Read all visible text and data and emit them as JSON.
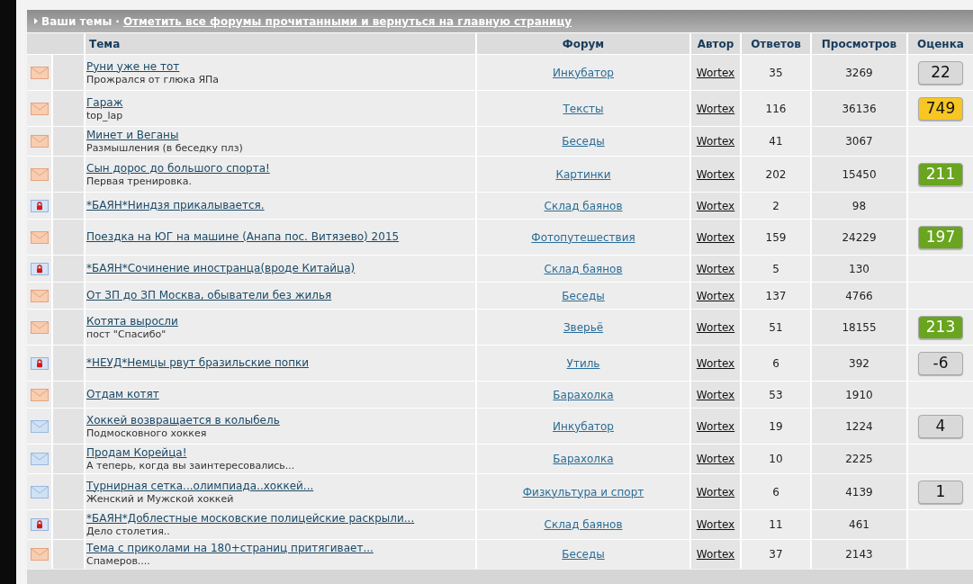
{
  "section_bar": {
    "title": "Ваши темы",
    "separator": "·",
    "link": "Отметить все форумы прочитанными и вернуться на главную страницу"
  },
  "table": {
    "columns": [
      "Тема",
      "Форум",
      "Автор",
      "Ответов",
      "Просмотров",
      "Оценка"
    ],
    "rows": [
      {
        "hot": true,
        "closed": false,
        "title": "Руни уже не тот",
        "subtitle": "Прожрался от глюка ЯПа",
        "forum": "Инкубатор",
        "author": "Wortex",
        "replies": "35",
        "views": "3269",
        "rating": {
          "value": "22",
          "color": "#d9d9d9"
        }
      },
      {
        "hot": true,
        "closed": false,
        "title": "Гараж",
        "subtitle": "top_lap",
        "forum": "Тексты",
        "author": "Wortex",
        "replies": "116",
        "views": "36136",
        "rating": {
          "value": "749",
          "color": "#f8c623"
        }
      },
      {
        "hot": true,
        "closed": false,
        "title": "Минет и Веганы",
        "subtitle": "Размышления (в беседку плз)",
        "forum": "Беседы",
        "author": "Wortex",
        "replies": "41",
        "views": "3067"
      },
      {
        "hot": true,
        "closed": false,
        "title": "Сын дорос до большого спорта!",
        "subtitle": "Первая тренировка.",
        "forum": "Картинки",
        "author": "Wortex",
        "replies": "202",
        "views": "15450",
        "rating": {
          "value": "211",
          "color": "#69a51e"
        }
      },
      {
        "hot": false,
        "closed": true,
        "title": "*БАЯН*Ниндзя прикалывается.",
        "forum": "Склад баянов",
        "author": "Wortex",
        "replies": "2",
        "views": "98"
      },
      {
        "hot": true,
        "closed": false,
        "title": "Поездка на ЮГ на машине (Анапа пос. Витязево) 2015",
        "forum": "Фотопутешествия",
        "author": "Wortex",
        "replies": "159",
        "views": "24229",
        "rating": {
          "value": "197",
          "color": "#69a51e"
        }
      },
      {
        "hot": false,
        "closed": true,
        "title": "*БАЯН*Сочинение иностранца(вроде Китайца)",
        "forum": "Склад баянов",
        "author": "Wortex",
        "replies": "5",
        "views": "130"
      },
      {
        "hot": true,
        "closed": false,
        "title": "От ЗП до ЗП Москва, обыватели без жилья",
        "forum": "Беседы",
        "author": "Wortex",
        "replies": "137",
        "views": "4766"
      },
      {
        "hot": true,
        "closed": false,
        "title": "Котята выросли",
        "subtitle": "пост \"Спасибо\"",
        "forum": "Зверьё",
        "author": "Wortex",
        "replies": "51",
        "views": "18155",
        "rating": {
          "value": "213",
          "color": "#69a51e"
        }
      },
      {
        "hot": false,
        "closed": true,
        "title": "*НЕУД*Немцы рвут бразильские попки",
        "forum": "Утиль",
        "author": "Wortex",
        "replies": "6",
        "views": "392",
        "rating": {
          "value": "-6",
          "color": "#d9d9d9"
        }
      },
      {
        "hot": true,
        "closed": false,
        "title": "Отдам котят",
        "forum": "Барахолка",
        "author": "Wortex",
        "replies": "53",
        "views": "1910"
      },
      {
        "hot": false,
        "closed": false,
        "title": "Хоккей возвращается в колыбель",
        "subtitle": "Подмосковного хоккея",
        "forum": "Инкубатор",
        "author": "Wortex",
        "replies": "19",
        "views": "1224",
        "rating": {
          "value": "4",
          "color": "#d9d9d9"
        }
      },
      {
        "hot": false,
        "closed": false,
        "title": "Продам Корейца!",
        "subtitle": "А теперь, когда вы заинтересовались...",
        "forum": "Барахолка",
        "author": "Wortex",
        "replies": "10",
        "views": "2225"
      },
      {
        "hot": false,
        "closed": false,
        "title": "Турнирная сетка...олимпиада..хоккей...",
        "subtitle": "Женский и Мужской хоккей",
        "forum": "Физкультура и спорт",
        "author": "Wortex",
        "replies": "6",
        "views": "4139",
        "rating": {
          "value": "1",
          "color": "#d9d9d9"
        }
      },
      {
        "hot": false,
        "closed": true,
        "title": "*БАЯН*Доблестные московские полицейские раскрыли...",
        "subtitle": "Дело столетия..",
        "forum": "Склад баянов",
        "author": "Wortex",
        "replies": "11",
        "views": "461"
      },
      {
        "hot": true,
        "closed": false,
        "title": "Тема с приколами на 180+страниц притягивает...",
        "subtitle": "Спамеров....",
        "forum": "Беседы",
        "author": "Wortex",
        "replies": "37",
        "views": "2143"
      }
    ]
  }
}
